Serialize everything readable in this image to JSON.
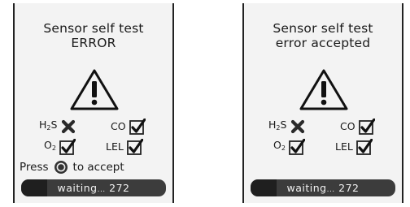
{
  "screens": [
    {
      "title_line1": "Sensor self test",
      "title_line2": "ERROR",
      "sensors": {
        "h2s": {
          "label": "H",
          "sub": "2",
          "suffix": "S",
          "status": "fail"
        },
        "co": {
          "label": "CO",
          "status": "pass"
        },
        "o2": {
          "label": "O",
          "sub": "2",
          "status": "pass"
        },
        "lel": {
          "label": "LEL",
          "status": "pass"
        }
      },
      "press_text": "Press",
      "accept_text": "to accept",
      "waiting_label": "waiting",
      "waiting_dots": "...",
      "waiting_count": "272",
      "progress_fraction": 0.18
    },
    {
      "title_line1": "Sensor self test",
      "title_line2": "error accepted",
      "sensors": {
        "h2s": {
          "label": "H",
          "sub": "2",
          "suffix": "S",
          "status": "fail"
        },
        "co": {
          "label": "CO",
          "status": "pass"
        },
        "o2": {
          "label": "O",
          "sub": "2",
          "status": "pass"
        },
        "lel": {
          "label": "LEL",
          "status": "pass"
        }
      },
      "waiting_label": "waiting",
      "waiting_dots": "...",
      "waiting_count": "272",
      "progress_fraction": 0.18
    }
  ]
}
